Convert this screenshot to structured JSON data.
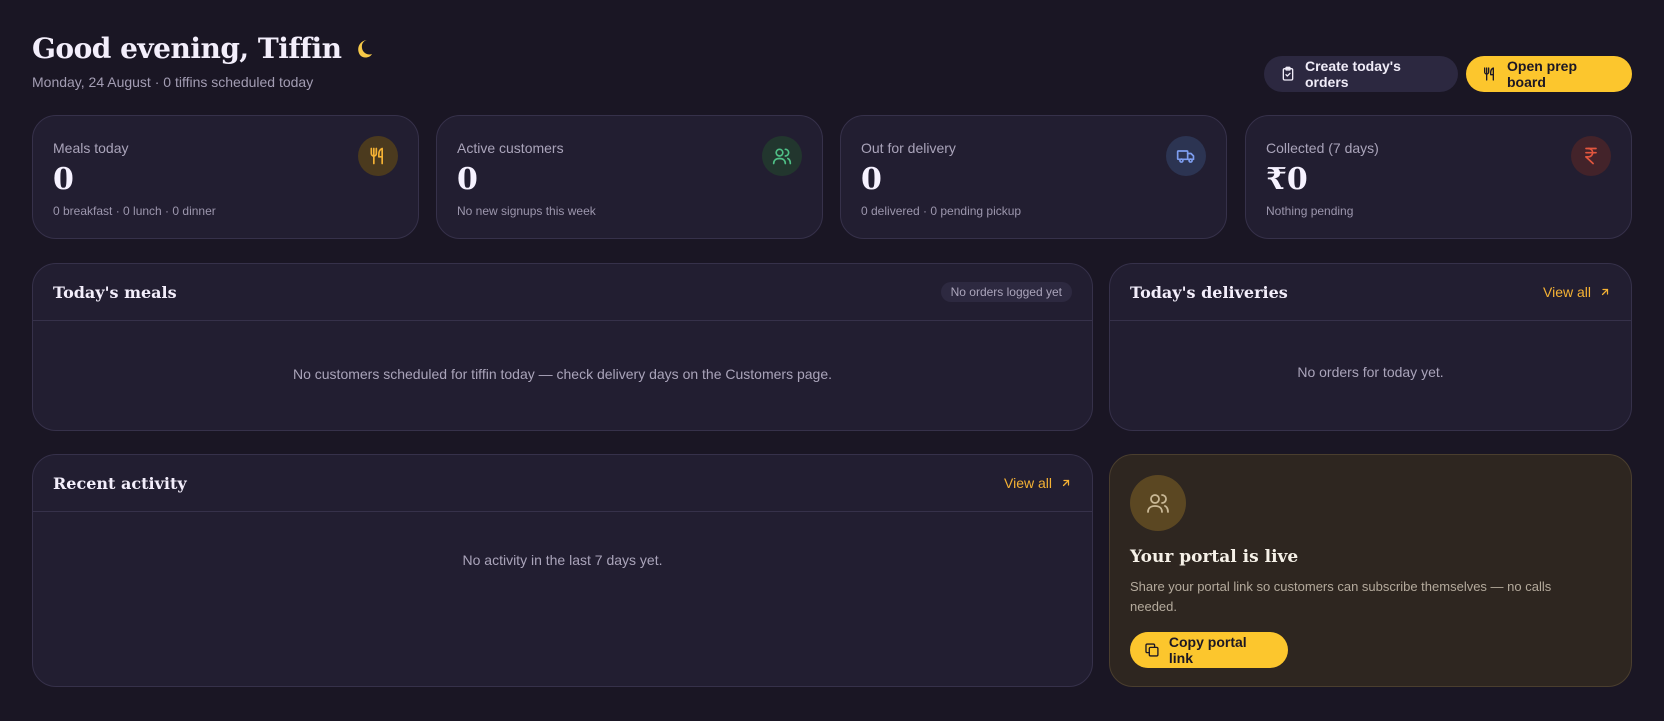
{
  "header": {
    "greeting": "Good evening, Tiffin",
    "subline": "Monday, 24 August · 0 tiffins scheduled today",
    "create_orders_label": "Create today's orders",
    "open_prep_label": "Open prep board"
  },
  "stats": [
    {
      "label": "Meals today",
      "value": "0",
      "sub": "0 breakfast · 0 lunch · 0 dinner",
      "icon": "utensils-icon",
      "color": "#f5b234"
    },
    {
      "label": "Active customers",
      "value": "0",
      "sub": "No new signups this week",
      "icon": "users-icon",
      "color": "#4fbf86"
    },
    {
      "label": "Out for delivery",
      "value": "0",
      "sub": "0 delivered · 0 pending pickup",
      "icon": "truck-icon",
      "color": "#7d9df0"
    },
    {
      "label": "Collected (7 days)",
      "value": "₹0",
      "sub": "Nothing pending",
      "icon": "rupee-icon",
      "color": "#e2563e"
    }
  ],
  "meals_panel": {
    "title": "Today's meals",
    "badge": "No orders logged yet",
    "empty": "No customers scheduled for tiffin today — check delivery days on the Customers page."
  },
  "deliveries_panel": {
    "title": "Today's deliveries",
    "link": "View all",
    "empty": "No orders for today yet."
  },
  "activity_panel": {
    "title": "Recent activity",
    "link": "View all",
    "empty": "No activity in the last 7 days yet."
  },
  "portal": {
    "title": "Your portal is live",
    "description": "Share your portal link so customers can subscribe themselves — no calls needed.",
    "button_label": "Copy portal link"
  },
  "colors": {
    "background": "#1a1624",
    "card": "#221e31",
    "accent": "#fcc62d",
    "link": "#f5b234"
  }
}
